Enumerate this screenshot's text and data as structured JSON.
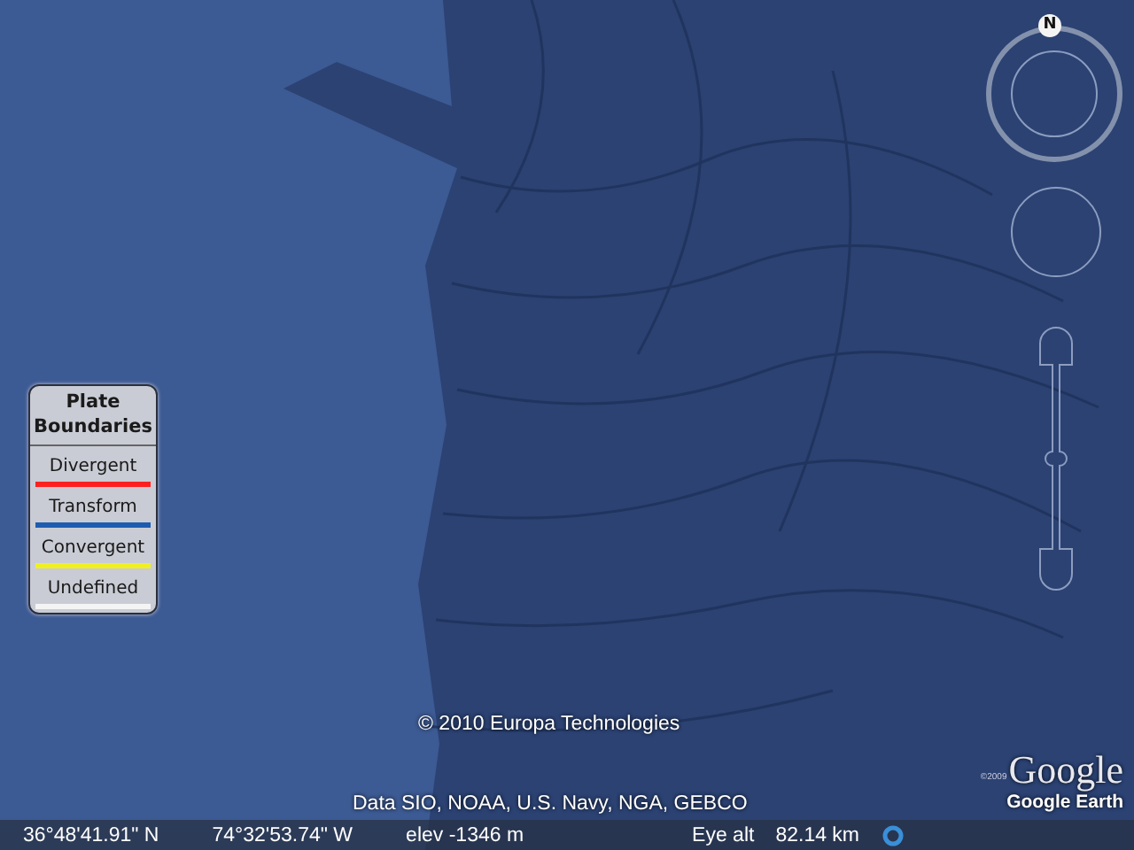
{
  "legend": {
    "title": "Plate Boundaries",
    "items": [
      {
        "label": "Divergent",
        "color": "#ff2020"
      },
      {
        "label": "Transform",
        "color": "#1e5cb0"
      },
      {
        "label": "Convergent",
        "color": "#f0f020"
      },
      {
        "label": "Undefined",
        "color": "#f4f4f4"
      }
    ]
  },
  "navigation": {
    "north_label": "N"
  },
  "attribution": "© 2010 Europa Technologies",
  "data_credit": "Data SIO, NOAA, U.S. Navy, NGA, GEBCO",
  "logo": {
    "copyright": "©2009",
    "name": "Google",
    "product": "Google Earth"
  },
  "status_bar": {
    "latitude": "36°48'41.91\" N",
    "longitude": "74°32'53.74\" W",
    "elevation": "elev -1346 m",
    "eye_alt_label": "Eye alt",
    "eye_alt": "82.14 km"
  }
}
